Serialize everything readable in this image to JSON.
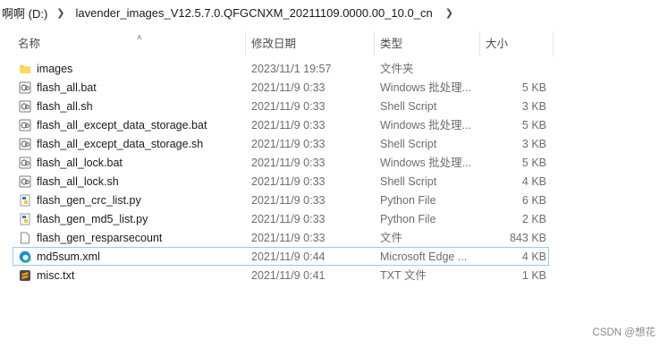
{
  "breadcrumb": {
    "drive": "啊啊 (D:)",
    "folder": "lavender_images_V12.5.7.0.QFGCNXM_20211109.0000.00_10.0_cn"
  },
  "columns": {
    "name": "名称",
    "date": "修改日期",
    "type": "类型",
    "size": "大小"
  },
  "files": [
    {
      "name": "images",
      "date": "2023/11/1 19:57",
      "type": "文件夹",
      "size": "",
      "icon": "folder-icon"
    },
    {
      "name": "flash_all.bat",
      "date": "2021/11/9 0:33",
      "type": "Windows 批处理...",
      "size": "5 KB",
      "icon": "batch-file-icon"
    },
    {
      "name": "flash_all.sh",
      "date": "2021/11/9 0:33",
      "type": "Shell Script",
      "size": "3 KB",
      "icon": "shell-script-icon"
    },
    {
      "name": "flash_all_except_data_storage.bat",
      "date": "2021/11/9 0:33",
      "type": "Windows 批处理...",
      "size": "5 KB",
      "icon": "batch-file-icon"
    },
    {
      "name": "flash_all_except_data_storage.sh",
      "date": "2021/11/9 0:33",
      "type": "Shell Script",
      "size": "3 KB",
      "icon": "shell-script-icon"
    },
    {
      "name": "flash_all_lock.bat",
      "date": "2021/11/9 0:33",
      "type": "Windows 批处理...",
      "size": "5 KB",
      "icon": "batch-file-icon"
    },
    {
      "name": "flash_all_lock.sh",
      "date": "2021/11/9 0:33",
      "type": "Shell Script",
      "size": "4 KB",
      "icon": "shell-script-icon"
    },
    {
      "name": "flash_gen_crc_list.py",
      "date": "2021/11/9 0:33",
      "type": "Python File",
      "size": "6 KB",
      "icon": "python-file-icon"
    },
    {
      "name": "flash_gen_md5_list.py",
      "date": "2021/11/9 0:33",
      "type": "Python File",
      "size": "2 KB",
      "icon": "python-file-icon"
    },
    {
      "name": "flash_gen_resparsecount",
      "date": "2021/11/9 0:33",
      "type": "文件",
      "size": "843 KB",
      "icon": "blank-file-icon"
    },
    {
      "name": "md5sum.xml",
      "date": "2021/11/9 0:44",
      "type": "Microsoft Edge ...",
      "size": "4 KB",
      "icon": "edge-icon",
      "selected": true
    },
    {
      "name": "misc.txt",
      "date": "2021/11/9 0:41",
      "type": "TXT 文件",
      "size": "1 KB",
      "icon": "sublime-text-icon"
    }
  ],
  "watermark": "CSDN @想花"
}
